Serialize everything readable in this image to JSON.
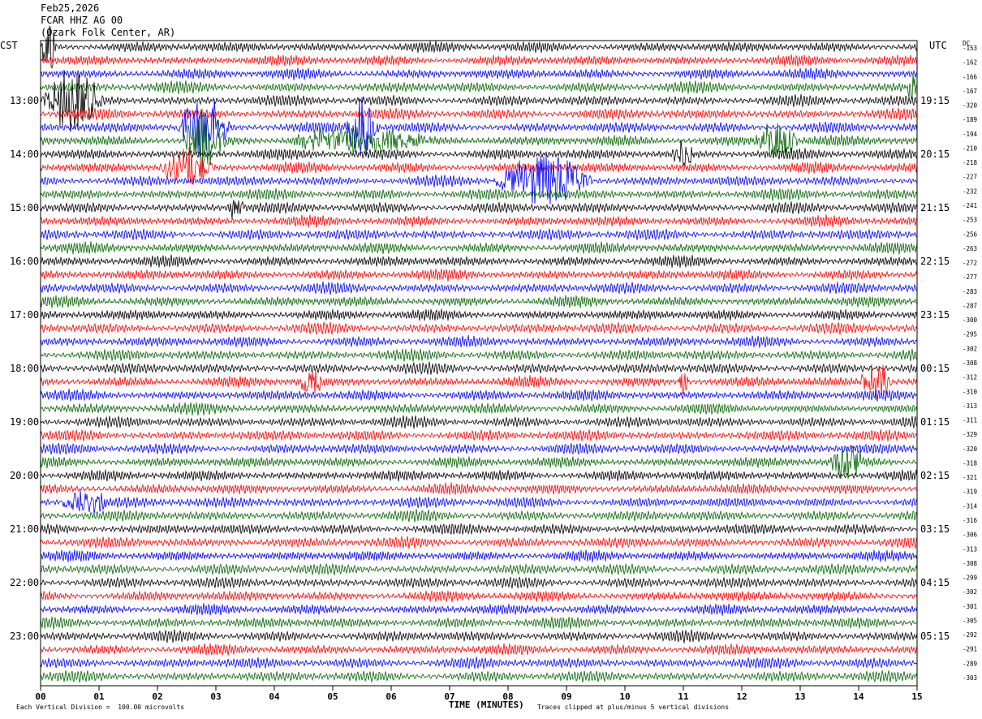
{
  "header": {
    "date": "Feb25,2026",
    "station": "FCAR HHZ AG 00",
    "location": "(Ozark Folk Center, AR)"
  },
  "left_zone": "CST",
  "right_zone": "UTC",
  "dc_label": "DC",
  "footer": {
    "left": "Each Vertical Division =  100.00 microvolts",
    "center": "TIME (MINUTES)",
    "right": "Traces clipped at plus/minus 5 vertical divisions"
  },
  "colors": {
    "black": "#000000",
    "red": "#ff0000",
    "blue": "#0000ff",
    "green": "#006400"
  },
  "chart_data": {
    "type": "line",
    "title": "",
    "xlabel": "TIME (MINUTES)",
    "x_ticks": [
      "00",
      "01",
      "02",
      "03",
      "04",
      "05",
      "06",
      "07",
      "08",
      "09",
      "10",
      "11",
      "12",
      "13",
      "14",
      "15"
    ],
    "xlim": [
      0,
      15
    ],
    "trace_count": 48,
    "trace_minutes": 15,
    "color_cycle": [
      "#000000",
      "#ff0000",
      "#0000ff",
      "#006400"
    ],
    "left_time_labels": [
      "13:00",
      "14:00",
      "15:00",
      "16:00",
      "17:00",
      "18:00",
      "19:00",
      "20:00",
      "21:00",
      "22:00",
      "23:00"
    ],
    "right_time_labels": [
      "19:15",
      "20:15",
      "21:15",
      "22:15",
      "23:15",
      "00:15",
      "01:15",
      "02:15",
      "03:15",
      "04:15",
      "05:15"
    ],
    "dc_offsets": [
      "-153",
      "-162",
      "-166",
      "-167",
      "-320",
      "-189",
      "-194",
      "-210",
      "-218",
      "-227",
      "-232",
      "-241",
      "-253",
      "-256",
      "-263",
      "-272",
      "-277",
      "-283",
      "-287",
      "-300",
      "-295",
      "-302",
      "-308",
      "-312",
      "-310",
      "-313",
      "-311",
      "-329",
      "-320",
      "-318",
      "-321",
      "-319",
      "-314",
      "-316",
      "-306",
      "-313",
      "-308",
      "-299",
      "-302",
      "-301",
      "-305",
      "-292",
      "-291",
      "-289",
      "-303"
    ],
    "events": [
      {
        "trace": 0,
        "start_min": 0.0,
        "end_min": 0.3,
        "amplitude": 5
      },
      {
        "trace": 3,
        "start_min": 14.8,
        "end_min": 15.0,
        "amplitude": 3
      },
      {
        "trace": 4,
        "start_min": 0.0,
        "end_min": 1.1,
        "amplitude": 5
      },
      {
        "trace": 6,
        "start_min": 2.3,
        "end_min": 3.3,
        "amplitude": 5
      },
      {
        "trace": 6,
        "start_min": 5.2,
        "end_min": 5.8,
        "amplitude": 5
      },
      {
        "trace": 7,
        "start_min": 2.4,
        "end_min": 3.2,
        "amplitude": 5
      },
      {
        "trace": 7,
        "start_min": 4.2,
        "end_min": 6.8,
        "amplitude": 2
      },
      {
        "trace": 7,
        "start_min": 12.2,
        "end_min": 13.0,
        "amplitude": 3
      },
      {
        "trace": 8,
        "start_min": 10.8,
        "end_min": 11.2,
        "amplitude": 2
      },
      {
        "trace": 9,
        "start_min": 2.0,
        "end_min": 3.0,
        "amplitude": 3
      },
      {
        "trace": 10,
        "start_min": 7.7,
        "end_min": 9.5,
        "amplitude": 4
      },
      {
        "trace": 12,
        "start_min": 3.2,
        "end_min": 3.5,
        "amplitude": 2
      },
      {
        "trace": 25,
        "start_min": 4.4,
        "end_min": 4.9,
        "amplitude": 2
      },
      {
        "trace": 25,
        "start_min": 10.9,
        "end_min": 11.1,
        "amplitude": 2
      },
      {
        "trace": 25,
        "start_min": 14.0,
        "end_min": 14.6,
        "amplitude": 3
      },
      {
        "trace": 31,
        "start_min": 13.5,
        "end_min": 14.1,
        "amplitude": 3
      },
      {
        "trace": 34,
        "start_min": 0.3,
        "end_min": 1.2,
        "amplitude": 2
      }
    ]
  }
}
